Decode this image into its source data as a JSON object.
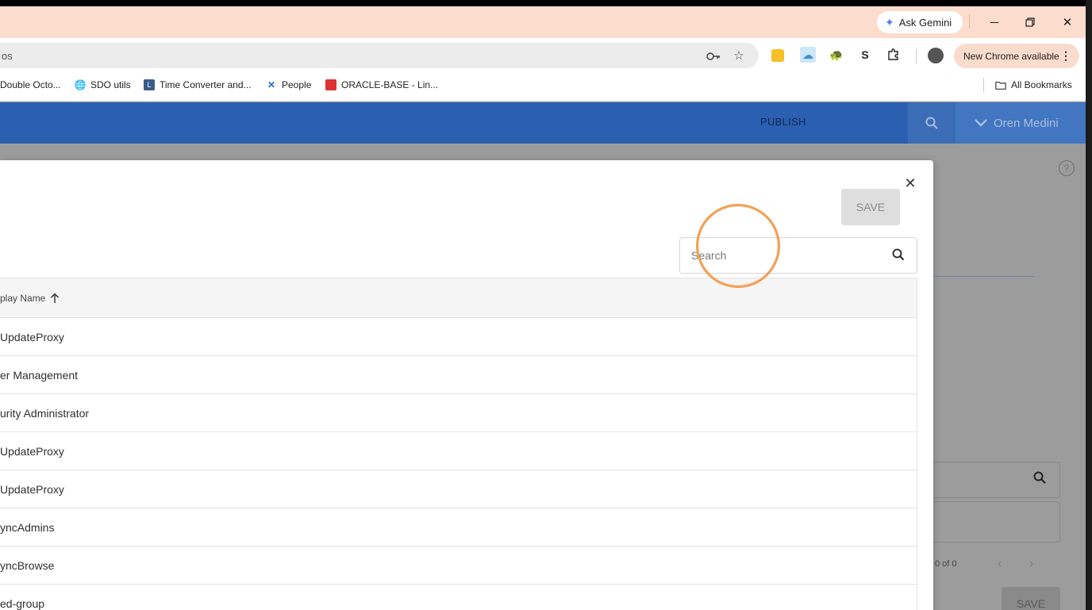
{
  "browser": {
    "gemini_label": "Ask Gemini",
    "address_fragment": "os",
    "update_label": "New Chrome available",
    "bookmarks": [
      {
        "label": "Double Octo...",
        "icon": "octocat-icon"
      },
      {
        "label": "SDO utils",
        "icon": "globe-icon"
      },
      {
        "label": "Time Converter and...",
        "icon": "clock-icon"
      },
      {
        "label": "People",
        "icon": "confluence-icon"
      },
      {
        "label": "ORACLE-BASE - Lin...",
        "icon": "oracle-icon"
      }
    ],
    "all_bookmarks_label": "All Bookmarks"
  },
  "app_header": {
    "publish_label": "PUBLISH",
    "user_name": "Oren Medini"
  },
  "modal": {
    "save_label": "SAVE",
    "search_placeholder": "Search",
    "column_header": "play Name",
    "rows": [
      "UpdateProxy",
      "er Management",
      "urity Administrator",
      "UpdateProxy",
      "UpdateProxy",
      "yncAdmins",
      "yncBrowse",
      "ed-group"
    ]
  },
  "background_page": {
    "pager_text": "0 of 0",
    "save_label": "SAVE"
  },
  "colors": {
    "header_blue": "#2b5fb0",
    "titlebar": "#fbdccd",
    "cursor_ring": "#f0a055"
  }
}
